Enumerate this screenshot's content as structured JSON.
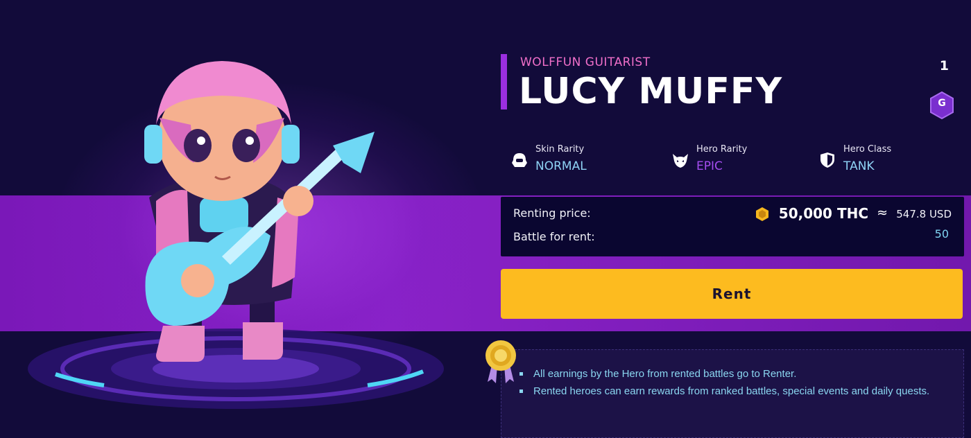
{
  "hero": {
    "subtitle": "WOLFFUN GUITARIST",
    "name": "LUCY MUFFY",
    "count": "1",
    "grade": "G"
  },
  "stats": [
    {
      "label": "Skin Rarity",
      "value": "NORMAL",
      "icon": "mech-helmet-icon",
      "color": "#8fd3f5"
    },
    {
      "label": "Hero Rarity",
      "value": "EPIC",
      "icon": "demon-mask-icon",
      "color": "#a64df0"
    },
    {
      "label": "Hero Class",
      "value": "TANK",
      "icon": "shield-icon",
      "color": "#8fd3f5"
    }
  ],
  "pricing": {
    "price_label": "Renting price:",
    "price_value": "50,000 THC",
    "approx_symbol": "≈",
    "usd_value": "547.8 USD",
    "battles_label": "Battle for rent:",
    "battles_value": "50"
  },
  "actions": {
    "rent_label": "Rent"
  },
  "notes": [
    "All earnings by the Hero from rented battles go to Renter.",
    "Rented heroes can earn rewards from ranked battles, special events and daily quests."
  ],
  "colors": {
    "background": "#120b3a",
    "band": "#8a22c8",
    "accent_pink": "#f06fc9",
    "rent_button": "#fdbb1f",
    "cyan_text": "#8fd3f5"
  }
}
